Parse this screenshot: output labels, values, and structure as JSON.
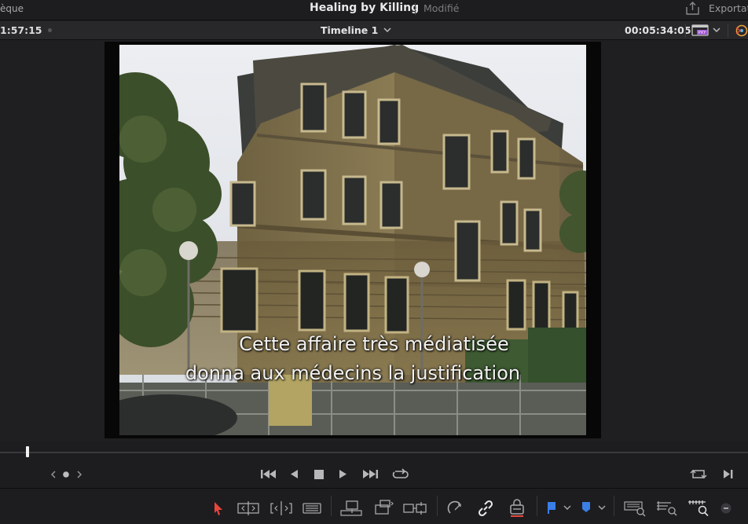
{
  "header": {
    "library_label": "èque",
    "project_title": "Healing by Killing",
    "status": "Modifié",
    "export_label": "Exportati"
  },
  "timeline_bar": {
    "timecode_left": "1:57:15",
    "timeline_name": "Timeline 1",
    "timecode_right": "00:05:34:05"
  },
  "viewer": {
    "subtitle_line1": "Cette affaire très médiatisée",
    "subtitle_line2": "donna aux médecins la justification"
  },
  "icons": {
    "export": "export-icon",
    "proxy": "proxy-film-icon",
    "color": "color-wheel-icon",
    "transport": [
      "jog-left-icon",
      "jog-dot-icon",
      "jog-right-icon",
      "first-frame-icon",
      "play-reverse-icon",
      "stop-icon",
      "play-icon",
      "last-frame-icon",
      "loop-icon",
      "match-frame-icon",
      "next-clip-icon"
    ],
    "tools": [
      "selection-arrow-icon",
      "trim-edit-icon",
      "dynamic-trim-icon",
      "blade-icon",
      "insert-clip-icon",
      "overwrite-clip-icon",
      "replace-clip-icon",
      "snapping-icon",
      "linked-selection-icon",
      "position-lock-icon",
      "flag-icon",
      "marker-icon",
      "zoom-full-icon",
      "zoom-detail-icon",
      "zoom-custom-icon",
      "zoom-out-icon"
    ]
  },
  "colors": {
    "accent_red": "#e8463c",
    "flag_blue": "#3a7ee6",
    "proxy_purple": "#a352d6"
  }
}
